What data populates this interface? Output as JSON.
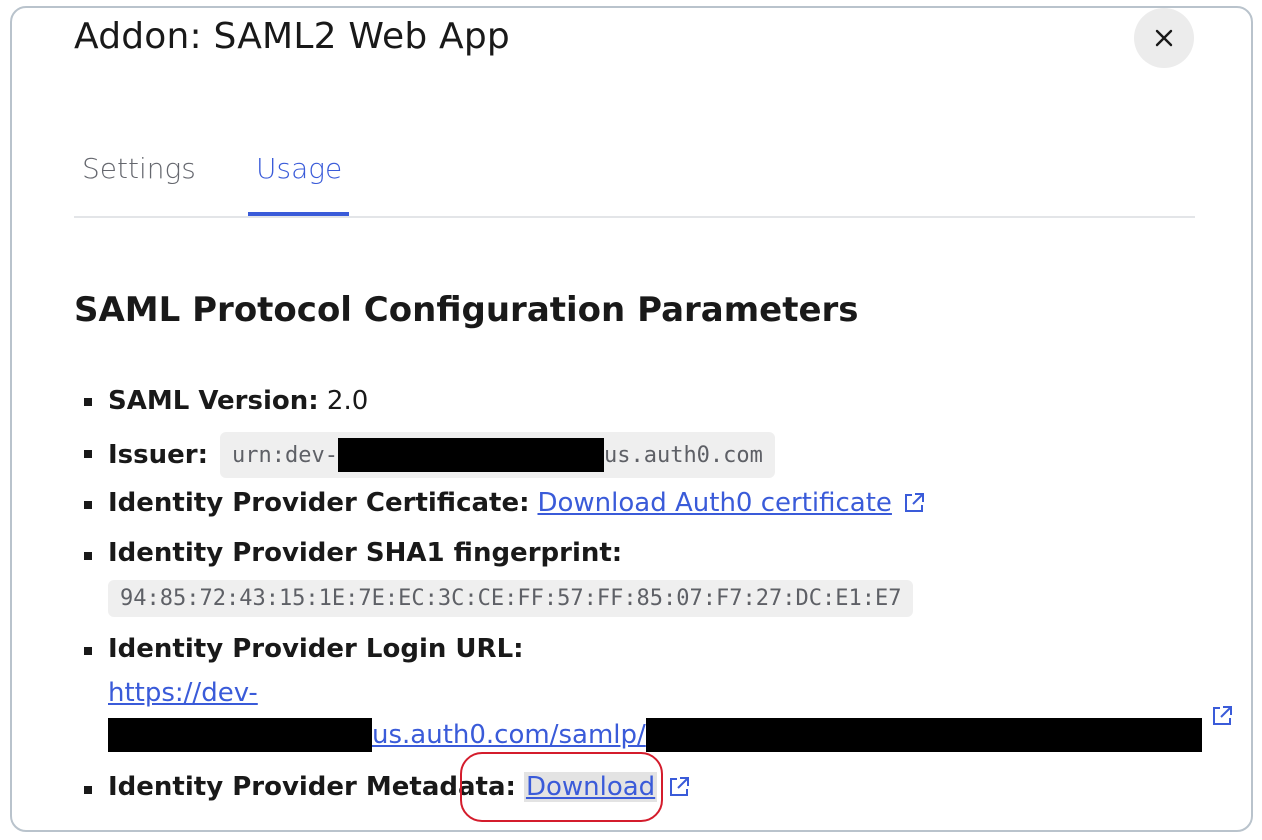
{
  "dialog": {
    "title": "Addon: SAML2 Web App",
    "close_label": "×"
  },
  "tabs": [
    {
      "label": "Settings",
      "active": false
    },
    {
      "label": "Usage",
      "active": true
    }
  ],
  "section": {
    "title": "SAML Protocol Configuration Parameters"
  },
  "params": {
    "saml_version": {
      "label": "SAML Version:",
      "value": "2.0"
    },
    "issuer": {
      "label": "Issuer:",
      "value_prefix": "urn:dev-",
      "value_suffix": "us.auth0.com"
    },
    "certificate": {
      "label": "Identity Provider Certificate:",
      "link": "Download Auth0 certificate"
    },
    "sha1": {
      "label": "Identity Provider SHA1 fingerprint:",
      "value": "94:85:72:43:15:1E:7E:EC:3C:CE:FF:57:FF:85:07:F7:27:DC:E1:E7"
    },
    "login_url": {
      "label": "Identity Provider Login URL:",
      "link_line1": "https://dev-",
      "link_line2_mid": "us.auth0.com/samlp/"
    },
    "metadata": {
      "label": "Identity Provider Metadata:",
      "link": "Download"
    }
  },
  "colors": {
    "accent": "#3a5bd9",
    "annotation": "#d41c2c"
  },
  "icons": [
    "close-icon",
    "external-link-icon"
  ]
}
